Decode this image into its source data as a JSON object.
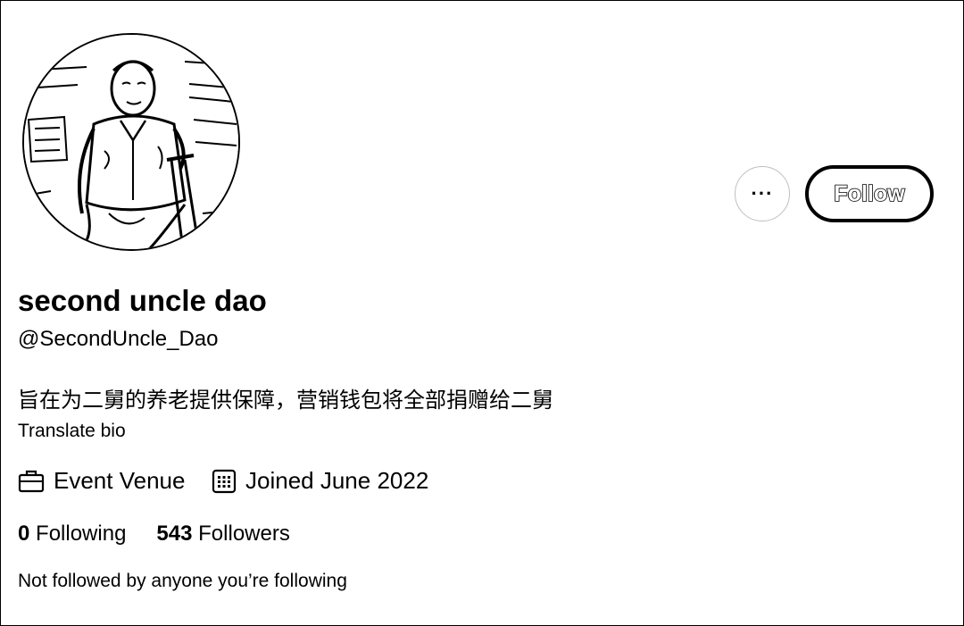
{
  "profile": {
    "avatar_icon": "profile-photo",
    "display_name": "second uncle dao",
    "handle": "@SecondUncle_Dao",
    "bio": "旨在为二舅的养老提供保障，营销钱包将全部捐赠给二舅",
    "translate_label": "Translate bio"
  },
  "actions": {
    "more_label": "···",
    "follow_label": "Follow"
  },
  "meta": {
    "category_icon": "briefcase-icon",
    "category": "Event Venue",
    "joined_icon": "calendar-icon",
    "joined": "Joined June 2022"
  },
  "stats": {
    "following_count": "0",
    "following_label": "Following",
    "followers_count": "543",
    "followers_label": "Followers"
  },
  "followers_note": "Not followed by anyone you’re following"
}
